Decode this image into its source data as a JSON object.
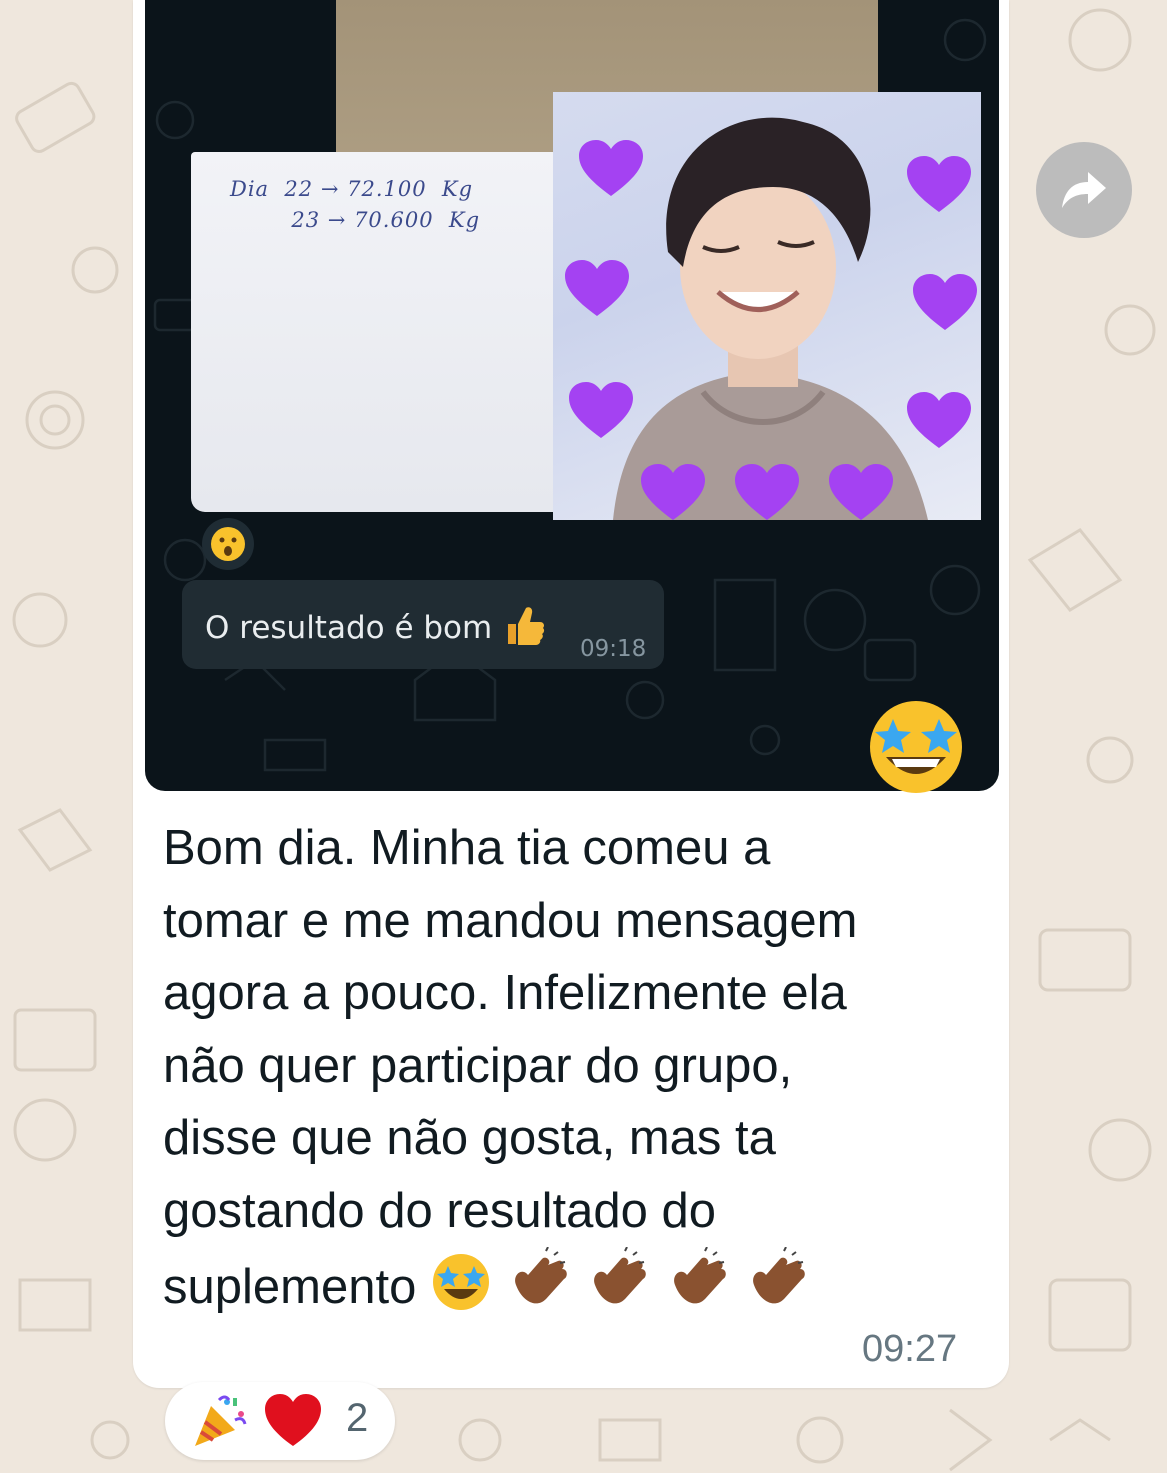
{
  "quoted_message": {
    "note_line1": "Dia  22 → 72.100  Kg",
    "note_line2": "        23 → 70.600  Kg",
    "reaction_emoji": "hushed-face",
    "inner_reply": {
      "text": "O resultado é bom",
      "emoji": "thumbs-up-icon",
      "time": "09:18"
    },
    "sticker": "star-struck-face"
  },
  "message": {
    "lines": [
      "Bom dia. Minha tia comeu a",
      "tomar e me mandou mensagem",
      "agora a pouco. Infelizmente ela",
      "não quer participar do grupo,",
      "disse que não gosta, mas ta",
      "gostando do resultado do",
      "suplemento"
    ],
    "trailing_emojis": [
      "star-struck-face",
      "clapping-hands",
      "clapping-hands",
      "clapping-hands",
      "clapping-hands"
    ],
    "time": "09:27"
  },
  "reactions": {
    "emojis": [
      "party-popper",
      "red-heart"
    ],
    "count": "2"
  },
  "colors": {
    "chat_background": "#efe7dd",
    "bubble": "#ffffff",
    "dark_screenshot": "#0b141a",
    "heart": "#a442f2"
  }
}
